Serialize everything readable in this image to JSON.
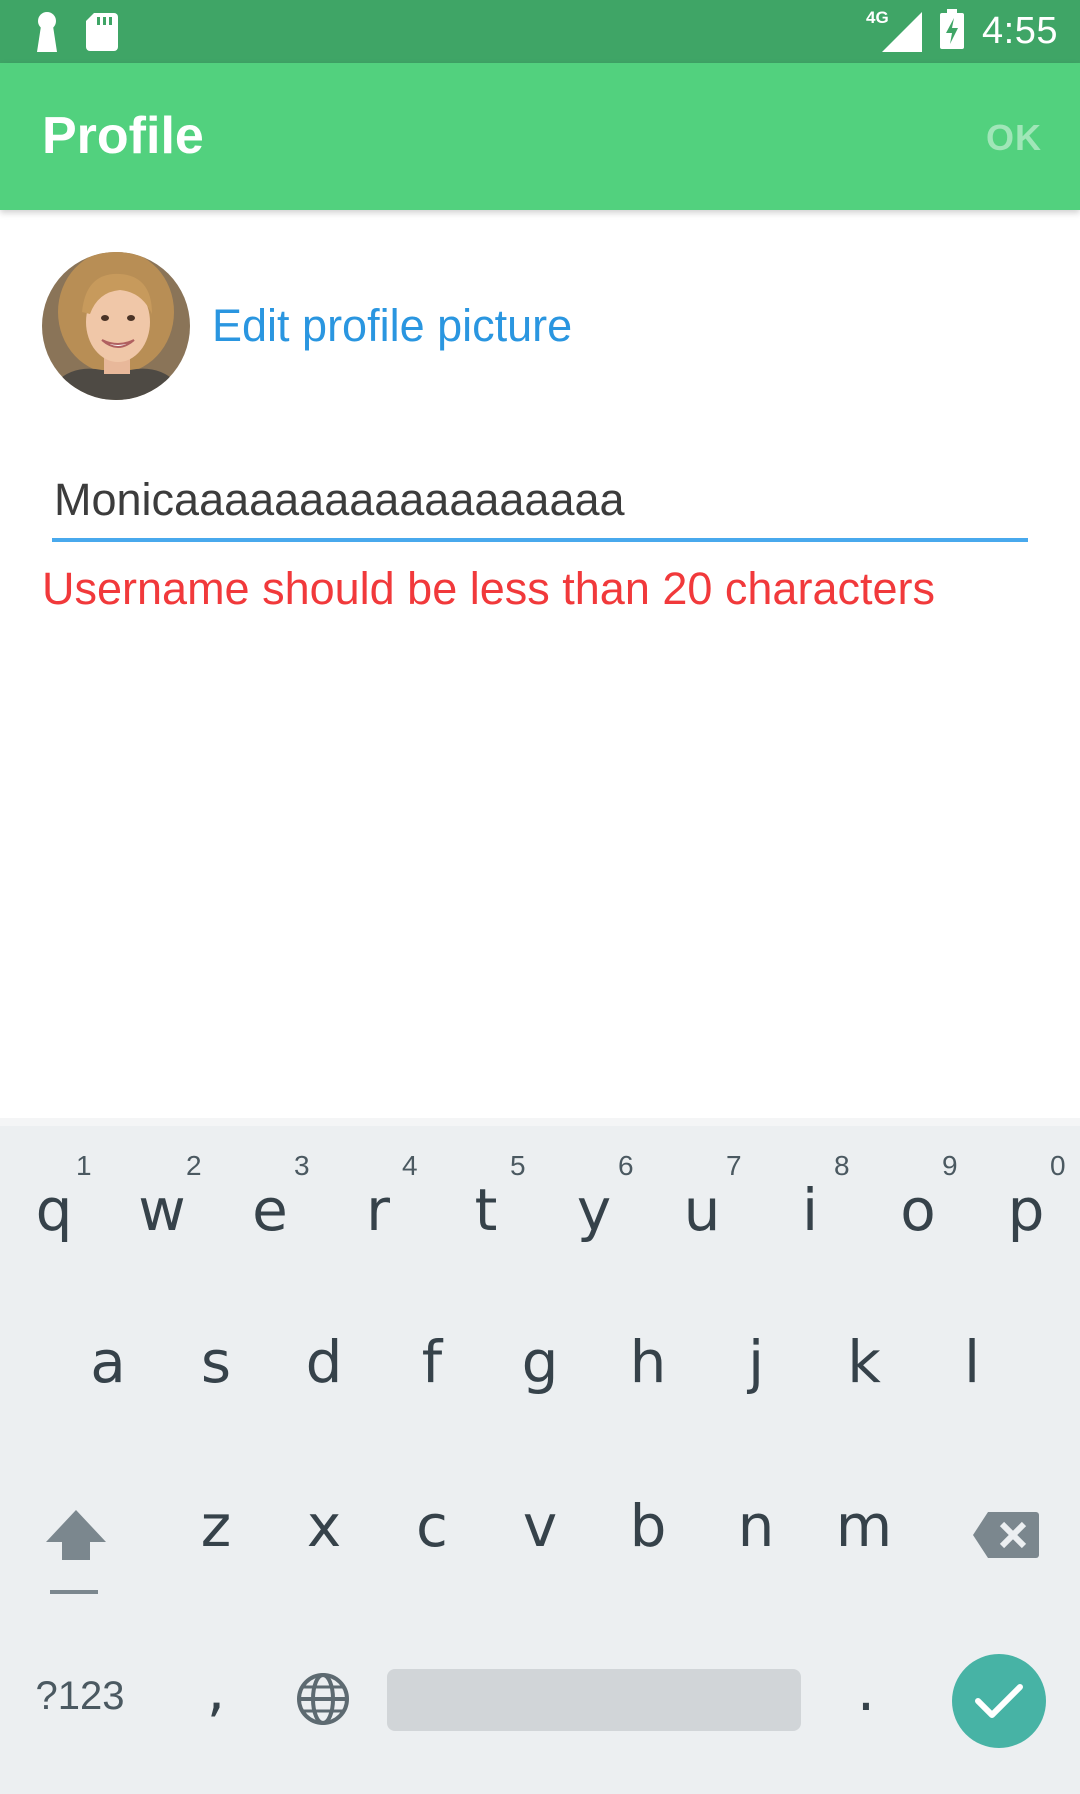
{
  "status_bar": {
    "network": "4G",
    "time": "4:55",
    "icons": [
      "keyhole-icon",
      "sd-card-icon",
      "signal-icon",
      "battery-charging-icon"
    ]
  },
  "app_bar": {
    "title": "Profile",
    "ok_label": "OK",
    "color": "#52d17e"
  },
  "profile": {
    "edit_picture_label": "Edit profile picture",
    "username_value": "Monicaaaaaaaaaaaaaaaaaa",
    "error_text": "Username should be less than 20 characters",
    "error_color": "#f1393b",
    "link_color": "#2a96e0"
  },
  "keyboard": {
    "row1": [
      {
        "key": "q",
        "hint": "1"
      },
      {
        "key": "w",
        "hint": "2"
      },
      {
        "key": "e",
        "hint": "3"
      },
      {
        "key": "r",
        "hint": "4"
      },
      {
        "key": "t",
        "hint": "5"
      },
      {
        "key": "y",
        "hint": "6"
      },
      {
        "key": "u",
        "hint": "7"
      },
      {
        "key": "i",
        "hint": "8"
      },
      {
        "key": "o",
        "hint": "9"
      },
      {
        "key": "p",
        "hint": "0"
      }
    ],
    "row2": [
      "a",
      "s",
      "d",
      "f",
      "g",
      "h",
      "j",
      "k",
      "l"
    ],
    "row3": [
      "z",
      "x",
      "c",
      "v",
      "b",
      "n",
      "m"
    ],
    "symbols_label": "?123",
    "comma_label": ",",
    "period_label": ".",
    "action_color": "#47b3a5"
  }
}
